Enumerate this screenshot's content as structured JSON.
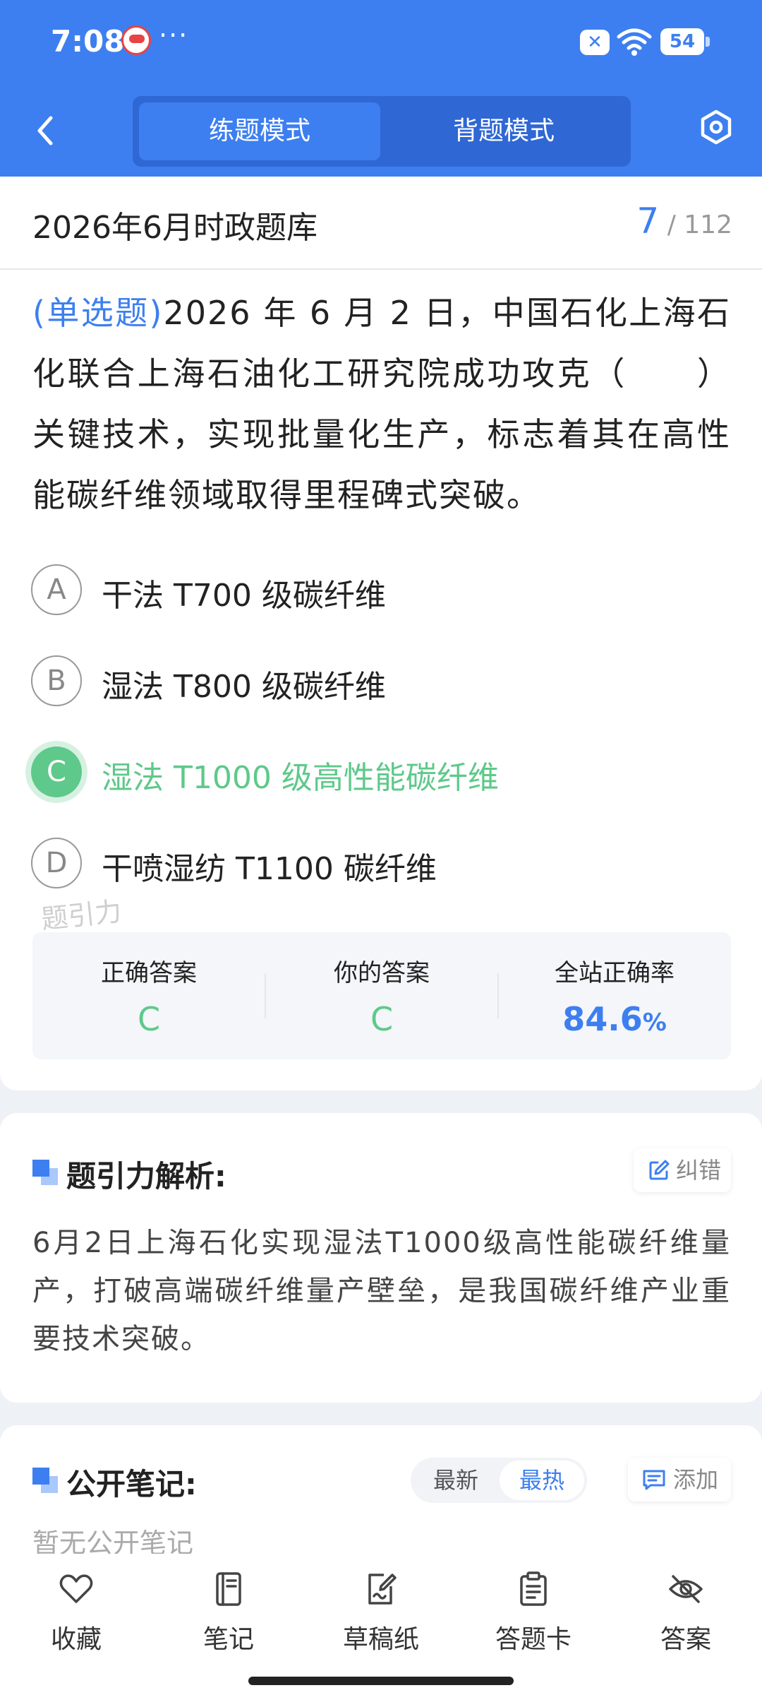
{
  "status_bar": {
    "time": "7:08",
    "dots": "···",
    "battery": "54"
  },
  "header": {
    "tabs": [
      {
        "label": "练题模式",
        "active": true
      },
      {
        "label": "背题模式",
        "active": false
      }
    ],
    "accent_color": "#3d7ff0"
  },
  "question_bank": {
    "title": "2026年6月时政题库",
    "current": "7",
    "separator": "/",
    "total": "112"
  },
  "question": {
    "type": "(单选题)",
    "text": "2026 年 6 月 2 日，中国石化上海石化联合上海石油化工研究院成功攻克（　　）关键技术，实现批量化生产，标志着其在高性能碳纤维领域取得里程碑式突破。",
    "options": [
      {
        "letter": "A",
        "text": "干法 T700 级碳纤维",
        "state": "normal"
      },
      {
        "letter": "B",
        "text": "湿法 T800 级碳纤维",
        "state": "normal"
      },
      {
        "letter": "C",
        "text": "湿法 T1000 级高性能碳纤维",
        "state": "correct"
      },
      {
        "letter": "D",
        "text": "干喷湿纺 T1100 碳纤维",
        "state": "normal"
      }
    ],
    "watermark": "题引力"
  },
  "stats": {
    "correct_answer_label": "正确答案",
    "correct_answer": "C",
    "your_answer_label": "你的答案",
    "your_answer": "C",
    "accuracy_label": "全站正确率",
    "accuracy_value": "84.6",
    "accuracy_unit": "%"
  },
  "analysis": {
    "title": "题引力解析:",
    "report_label": "纠错",
    "text": "6月2日上海石化实现湿法T1000级高性能碳纤维量产，打破高端碳纤维量产壁垒，是我国碳纤维产业重要技术突破。"
  },
  "notes": {
    "title": "公开笔记:",
    "sort_newest": "最新",
    "sort_hot": "最热",
    "add_label": "添加",
    "empty_text": "暂无公开笔记"
  },
  "bottom_nav": [
    {
      "label": "收藏",
      "icon": "heart-icon"
    },
    {
      "label": "笔记",
      "icon": "notebook-icon"
    },
    {
      "label": "草稿纸",
      "icon": "draft-paper-icon"
    },
    {
      "label": "答题卡",
      "icon": "answer-sheet-icon"
    },
    {
      "label": "答案",
      "icon": "eye-off-icon"
    }
  ]
}
